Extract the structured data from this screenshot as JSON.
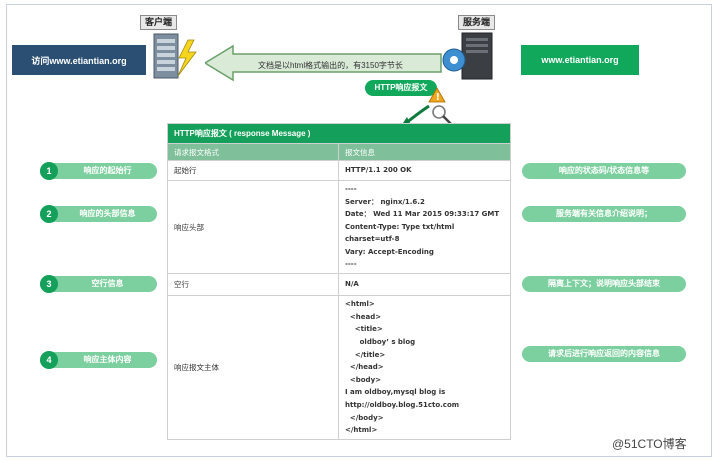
{
  "header": {
    "client_label": "客户端",
    "server_label": "服务端",
    "client_url_text": "访问www.etiantian.org",
    "server_url_text": "www.etiantian.org",
    "arrow_text": "文档是以html格式输出的，有3150字节长",
    "response_pill": "HTTP响应报文"
  },
  "table": {
    "title": "HTTP响应报文 ( response Message )",
    "col_headers": [
      "请求报文格式",
      "报文信息"
    ],
    "rows": [
      {
        "label": "起始行",
        "lines": [
          "HTTP/1.1 200 OK"
        ]
      },
      {
        "label": "响应头部",
        "lines": [
          "----",
          "Server： nginx/1.6.2",
          "Date： Wed 11 Mar 2015 09:33:17 GMT",
          "Content-Type: Type txt/html",
          "charset=utf-8",
          "Vary: Accept-Encoding",
          "----"
        ]
      },
      {
        "label": "空行",
        "lines": [
          "N/A"
        ]
      },
      {
        "label": "响应报文主体",
        "lines": [
          "<html>",
          "  <head>",
          "    <title>",
          "      oldboy’ s blog",
          "    </title>",
          "  </head>",
          "  <body>",
          "I am oldboy,mysql blog is",
          "http://oldboy.blog.51cto.com",
          "  </body>",
          "</html>"
        ]
      }
    ]
  },
  "left_items": [
    {
      "num": "1",
      "text": "响应的起始行"
    },
    {
      "num": "2",
      "text": "响应的头部信息"
    },
    {
      "num": "3",
      "text": "空行信息"
    },
    {
      "num": "4",
      "text": "响应主体内容"
    }
  ],
  "right_items": [
    {
      "text": "响应的状态码/状态信息等"
    },
    {
      "text": "服务端有关信息介绍说明；"
    },
    {
      "text": "隔离上下文；说明响应头部结束"
    },
    {
      "text": "请求后进行响应返回的内容信息"
    }
  ],
  "watermark": "@51CTO博客",
  "colors": {
    "green": "#14a05a",
    "light_green": "#7ccf9e",
    "navy": "#2b4f72"
  }
}
